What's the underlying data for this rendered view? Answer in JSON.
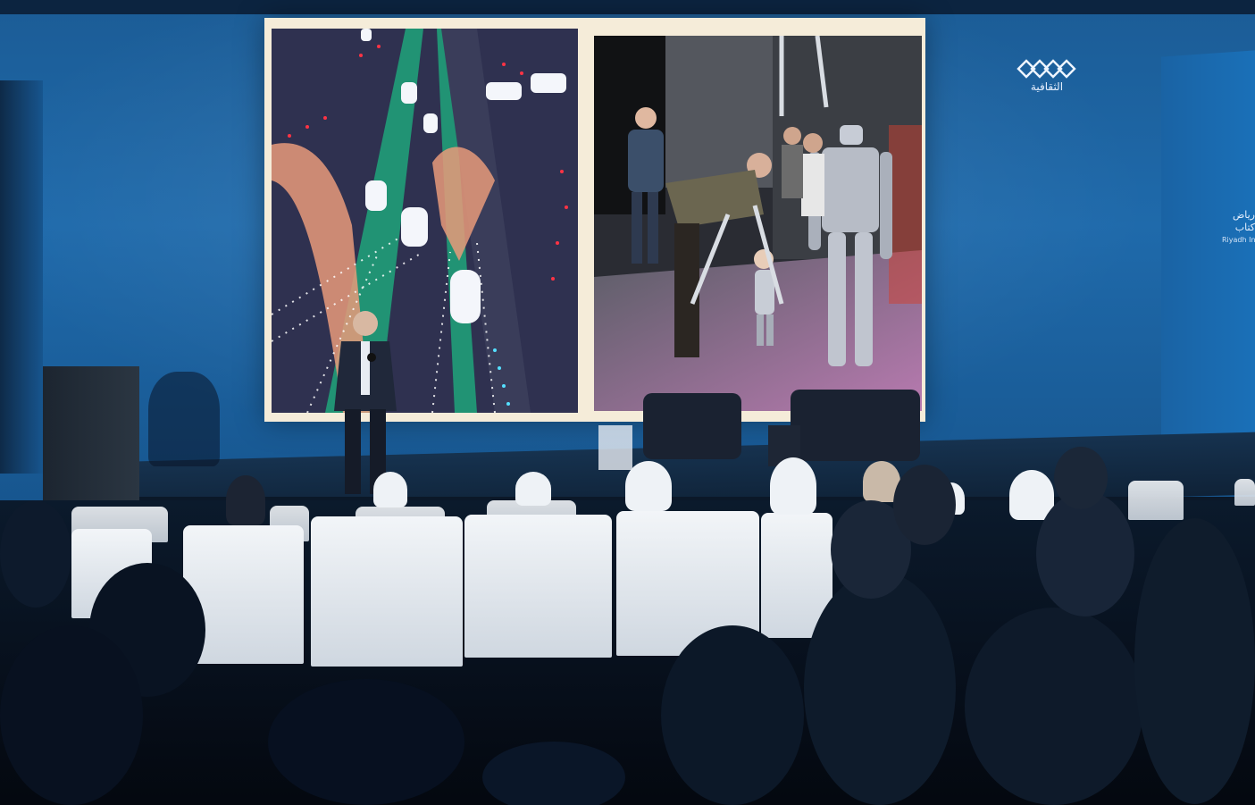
{
  "logo": {
    "text": "الثقافية"
  },
  "side_sign": {
    "line1": "رياض",
    "line2": "كتاب",
    "line3": "Riyadh Inter"
  }
}
